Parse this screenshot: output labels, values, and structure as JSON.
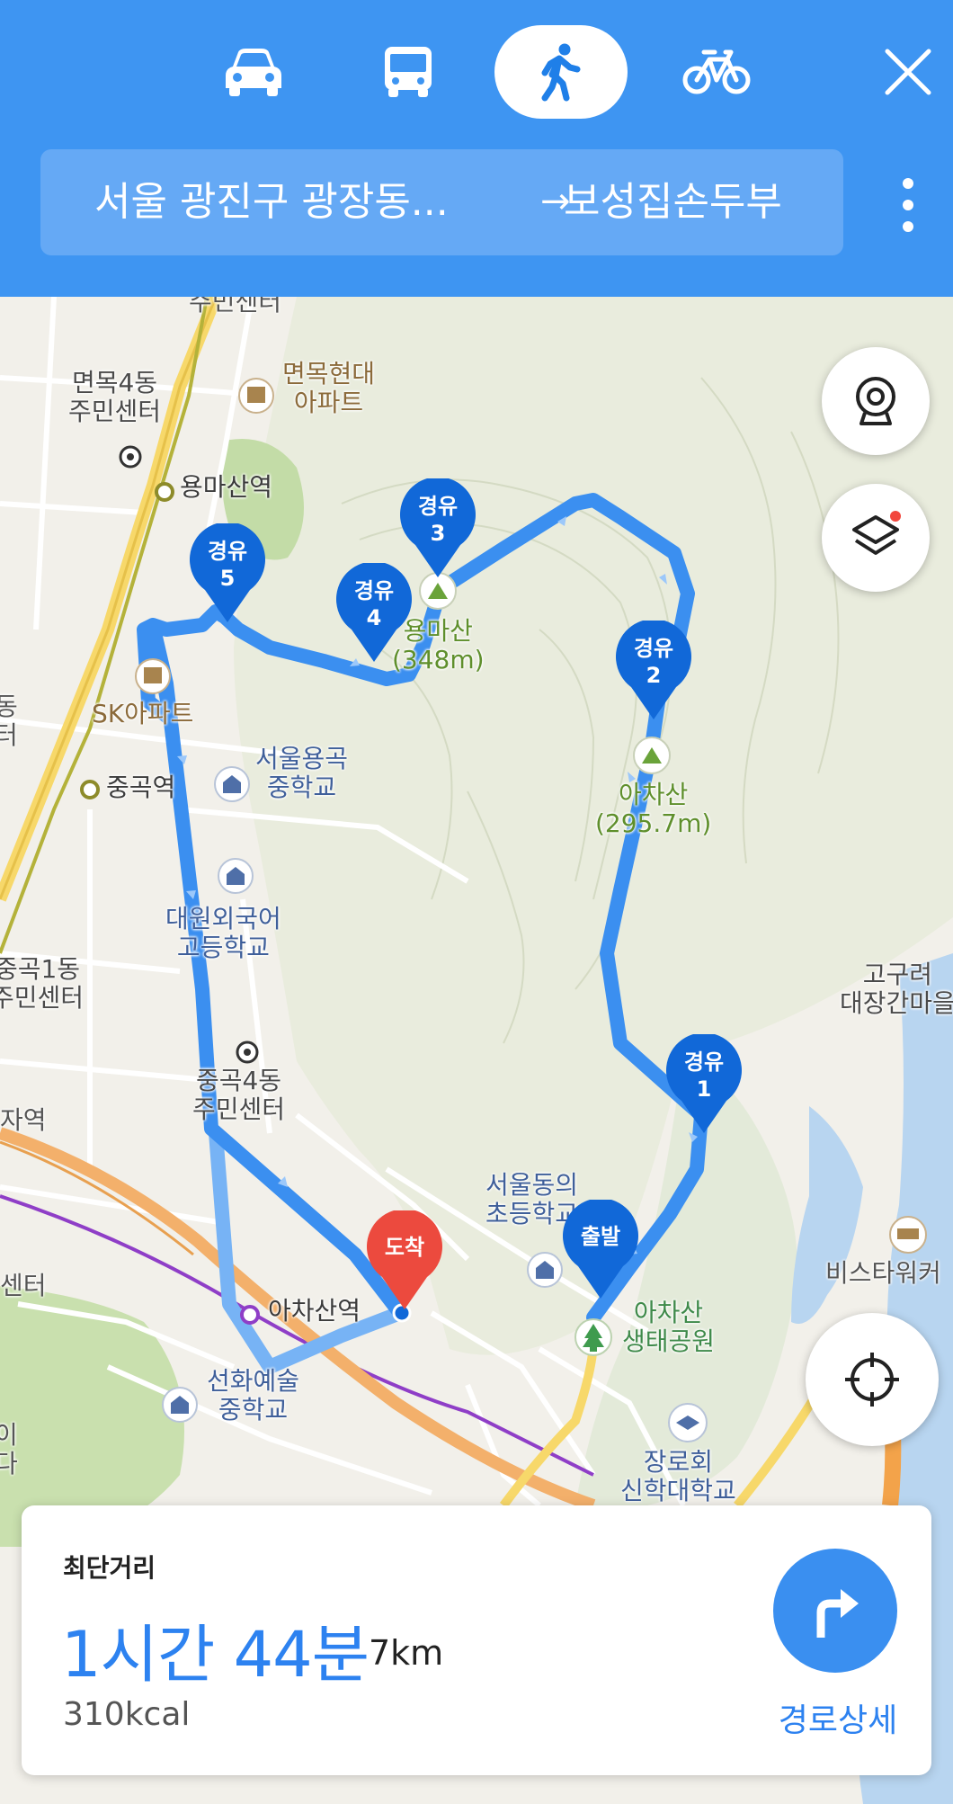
{
  "header": {
    "modes": [
      {
        "name": "car-mode",
        "icon": "car-icon",
        "selected": false
      },
      {
        "name": "bus-mode",
        "icon": "bus-icon",
        "selected": false
      },
      {
        "name": "walk-mode",
        "icon": "walk-icon",
        "selected": true
      },
      {
        "name": "bike-mode",
        "icon": "bike-icon",
        "selected": false
      }
    ],
    "origin": "서울 광진구 광장동...",
    "arrow": "→",
    "destination": "보성집손두부"
  },
  "map": {
    "labels": {
      "myeonmok4": "면목4동\n주민센터",
      "myeonmok_apt": "면목현대\n아파트",
      "yongmasan_station": "용마산역",
      "sk_apt": "SK아파트",
      "junggok_station": "중곡역",
      "seoul_yonggok_ms": "서울용곡\n중학교",
      "daewon_fl_hs": "대원외국어\n고등학교",
      "junggok1": "중곡1동\n주민센터",
      "junggok4": "중곡4동\n주민센터",
      "left_station": "자역",
      "left_center": "센터",
      "seoul_dong_es": "서울동의\n초등학교",
      "achasan_station": "아차산역",
      "seonhwa_arts_ms": "선화예술\n중학교",
      "achasan_eco_park": "아차산\n생태공원",
      "presbyterian_univ": "장로회\n신학대학교",
      "bistar": "비스타워커",
      "goguryeo": "고구려\n대장간마을",
      "yongmasan_peak": "용마산\n(348m)",
      "achasan_peak": "아차산\n(295.7m)",
      "top_center": "주민센터",
      "left_edge1": "동\n터",
      "left_edge2": "이\n다"
    },
    "pins": {
      "waypoint_label": "경유",
      "start": "출발",
      "arrival": "도착",
      "waypoints": [
        "1",
        "2",
        "3",
        "4",
        "5"
      ]
    },
    "colors": {
      "route": "#3b8ff0",
      "route_light": "#77b3f5",
      "pin_waypoint": "#1168d8",
      "pin_arrival": "#ec4a3e",
      "header_bg": "#3e95f2"
    }
  },
  "card": {
    "route_type": "최단거리",
    "duration": "1시간 44분",
    "distance": "7km",
    "calories": "310kcal",
    "detail_label": "경로상세"
  }
}
